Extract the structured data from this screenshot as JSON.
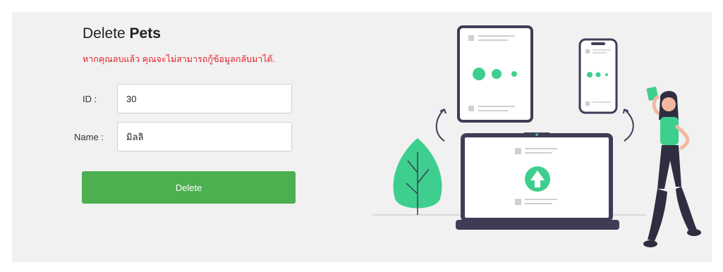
{
  "form": {
    "title_prefix": "Delete ",
    "title_bold": "Pets",
    "warning": "หากคุณลบแล้ว คุณจะไม่สามารถกู้ข้อมูลกลับมาได้.",
    "id_label": "ID :",
    "id_value": "30",
    "name_label": "Name :",
    "name_value": "มิลลิ",
    "delete_label": "Delete"
  },
  "colors": {
    "accent_green": "#4caf50",
    "warning_red": "#e8202a",
    "illustration_green": "#3ecf8e",
    "illustration_dark": "#3f3d56"
  },
  "illustration": {
    "name": "devices-person-illustration"
  }
}
